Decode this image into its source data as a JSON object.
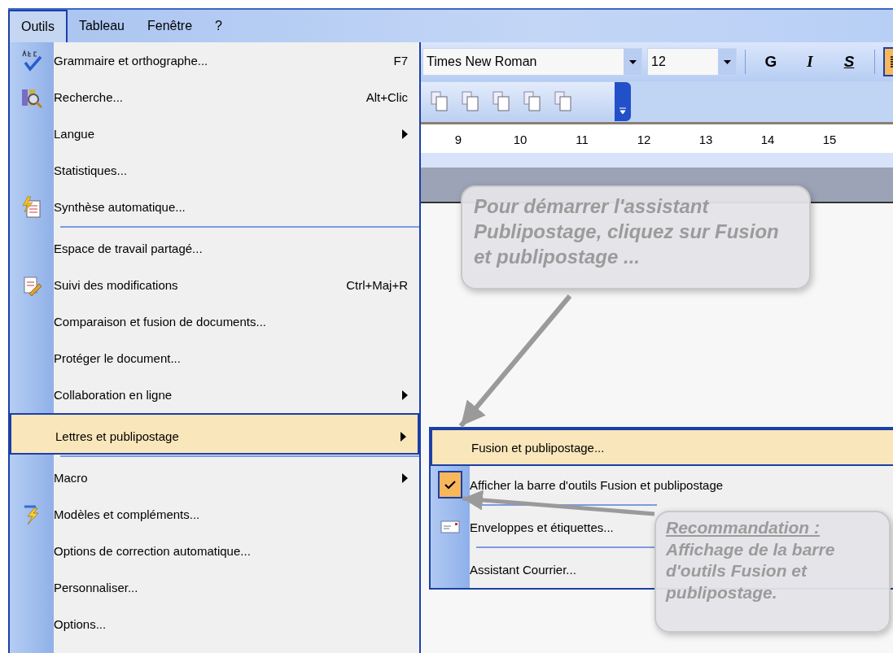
{
  "menu_bar": [
    {
      "label": "Outils",
      "selected": true
    },
    {
      "label": "Tableau",
      "selected": false
    },
    {
      "label": "Fenêtre",
      "selected": false
    },
    {
      "label": "?",
      "selected": false
    }
  ],
  "tools_menu": [
    {
      "label": "Grammaire et orthographe...",
      "shortcut": "F7",
      "submenu": false,
      "selected": false,
      "separator_before": false
    },
    {
      "label": "Recherche...",
      "shortcut": "Alt+Clic",
      "submenu": false,
      "selected": false,
      "separator_before": false
    },
    {
      "label": "Langue",
      "submenu": true,
      "selected": false,
      "separator_before": false
    },
    {
      "label": "Statistiques...",
      "submenu": false,
      "selected": false,
      "separator_before": false
    },
    {
      "label": "Synthèse automatique...",
      "submenu": false,
      "selected": false,
      "separator_before": false
    },
    {
      "label": "Espace de travail partagé...",
      "submenu": false,
      "selected": false,
      "separator_before": true
    },
    {
      "label": "Suivi des modifications",
      "shortcut": "Ctrl+Maj+R",
      "submenu": false,
      "selected": false,
      "separator_before": false
    },
    {
      "label": "Comparaison et fusion de documents...",
      "submenu": false,
      "selected": false,
      "separator_before": false
    },
    {
      "label": "Protéger le document...",
      "submenu": false,
      "selected": false,
      "separator_before": false
    },
    {
      "label": "Collaboration en ligne",
      "submenu": true,
      "selected": false,
      "separator_before": false
    },
    {
      "label": "Lettres et publipostage",
      "submenu": true,
      "selected": true,
      "separator_before": true
    },
    {
      "label": "Macro",
      "submenu": true,
      "selected": false,
      "separator_before": true
    },
    {
      "label": "Modèles et compléments...",
      "submenu": false,
      "selected": false,
      "separator_before": false
    },
    {
      "label": "Options de correction automatique...",
      "submenu": false,
      "selected": false,
      "separator_before": false
    },
    {
      "label": "Personnaliser...",
      "submenu": false,
      "selected": false,
      "separator_before": false
    },
    {
      "label": "Options...",
      "submenu": false,
      "selected": false,
      "separator_before": false
    }
  ],
  "toolbar": {
    "font_box": "Times New Roman",
    "size_box": "12",
    "format_buttons": [
      {
        "label": "G",
        "kind": "bold"
      },
      {
        "label": "I",
        "kind": "italic"
      },
      {
        "label": "S",
        "kind": "underline"
      }
    ],
    "align_button": {
      "selected": true
    }
  },
  "ruler": {
    "numbers": [
      "9",
      "10",
      "11",
      "12",
      "13",
      "14",
      "15"
    ]
  },
  "letters_submenu": [
    {
      "label": "Fusion et publipostage...",
      "selected": true,
      "checked": false,
      "separator_before": false
    },
    {
      "label": "Afficher la barre d'outils Fusion et publipostage",
      "selected": false,
      "checked": true,
      "separator_before": false
    },
    {
      "label": "Enveloppes et étiquettes...",
      "selected": false,
      "checked": false,
      "separator_before": true
    },
    {
      "label": "Assistant Courrier...",
      "selected": false,
      "checked": false,
      "separator_before": true
    }
  ],
  "callouts": [
    {
      "text": "Pour démarrer l'assistant Publipostage, cliquez sur Fusion et publipostage ..."
    },
    {
      "heading": "Recommandation :",
      "text": "Affichage de la barre d'outils Fusion et publipostage."
    }
  ]
}
